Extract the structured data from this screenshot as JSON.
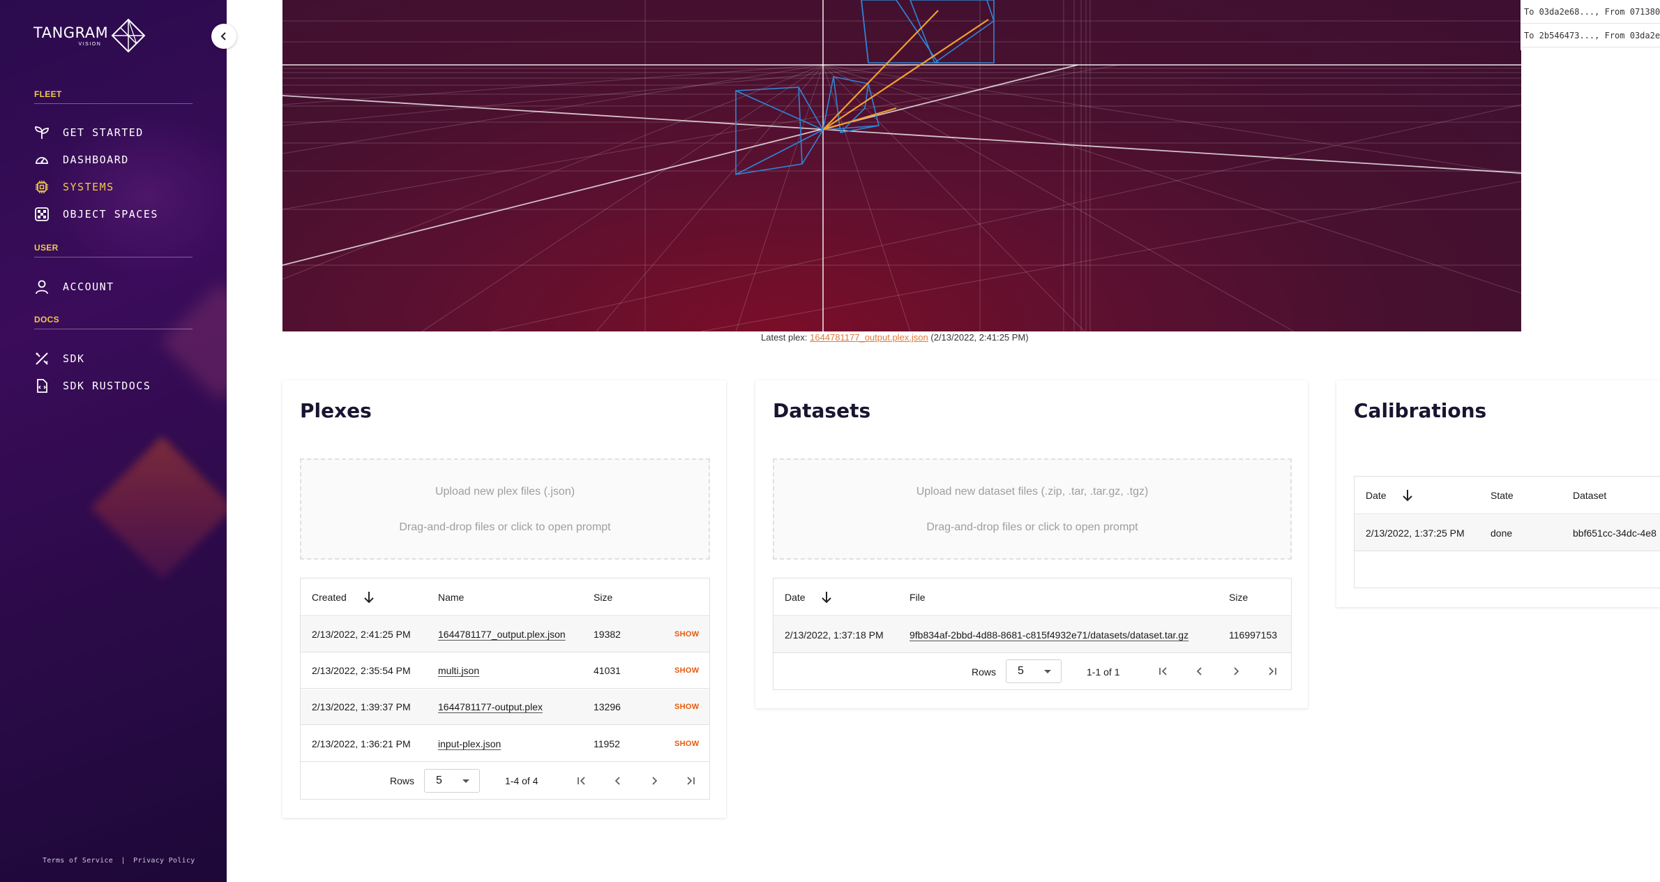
{
  "brand": {
    "name": "TANGRAM",
    "sub": "VISION"
  },
  "sidebar": {
    "sections": [
      {
        "title": "FLEET"
      },
      {
        "title": "USER"
      },
      {
        "title": "DOCS"
      }
    ],
    "items": [
      {
        "label": "GET STARTED",
        "icon": "sprout-icon"
      },
      {
        "label": "DASHBOARD",
        "icon": "gauge-icon"
      },
      {
        "label": "SYSTEMS",
        "icon": "chip-icon",
        "active": true
      },
      {
        "label": "OBJECT SPACES",
        "icon": "checkerboard-icon"
      },
      {
        "label": "ACCOUNT",
        "icon": "user-icon"
      },
      {
        "label": "SDK",
        "icon": "tools-icon"
      },
      {
        "label": "SDK RUSTDOCS",
        "icon": "code-file-icon"
      }
    ],
    "footer": {
      "terms": "Terms of Service",
      "sep": "|",
      "privacy": "Privacy Policy"
    }
  },
  "log": {
    "rows": [
      "To 03da2e68..., From 071380",
      "To 2b546473..., From 03da2e"
    ]
  },
  "viewer": {
    "latest_prefix": "Latest plex:",
    "latest_file": "1644781177_output.plex.json",
    "latest_date": "(2/13/2022, 2:41:25 PM)"
  },
  "plexes": {
    "title": "Plexes",
    "upload_line1": "Upload new plex files (.json)",
    "upload_line2": "Drag-and-drop files or click to open prompt",
    "columns": {
      "created": "Created",
      "name": "Name",
      "size": "Size"
    },
    "rows": [
      {
        "created": "2/13/2022, 2:41:25 PM",
        "name": "1644781177_output.plex.json",
        "size": "19382",
        "action": "SHOW"
      },
      {
        "created": "2/13/2022, 2:35:54 PM",
        "name": "multi.json",
        "size": "41031",
        "action": "SHOW"
      },
      {
        "created": "2/13/2022, 1:39:37 PM",
        "name": "1644781177-output.plex",
        "size": "13296",
        "action": "SHOW"
      },
      {
        "created": "2/13/2022, 1:36:21 PM",
        "name": "input-plex.json",
        "size": "11952",
        "action": "SHOW"
      }
    ],
    "pager": {
      "rows_label": "Rows",
      "rows_value": "5",
      "range": "1-4 of 4"
    }
  },
  "datasets": {
    "title": "Datasets",
    "upload_line1": "Upload new dataset files (.zip, .tar, .tar.gz, .tgz)",
    "upload_line2": "Drag-and-drop files or click to open prompt",
    "columns": {
      "date": "Date",
      "file": "File",
      "size": "Size"
    },
    "rows": [
      {
        "date": "2/13/2022, 1:37:18 PM",
        "file": "9fb834af-2bbd-4d88-8681-c815f4932e71/datasets/dataset.tar.gz",
        "size": "116997153"
      }
    ],
    "pager": {
      "rows_label": "Rows",
      "rows_value": "5",
      "range": "1-1 of 1"
    }
  },
  "calibrations": {
    "title": "Calibrations",
    "columns": {
      "date": "Date",
      "state": "State",
      "dataset": "Dataset"
    },
    "rows": [
      {
        "date": "2/13/2022, 1:37:25 PM",
        "state": "done",
        "dataset": "bbf651cc-34dc-4e8"
      }
    ]
  },
  "colors": {
    "accent": "#f2c94c",
    "link": "#e07a3a",
    "show": "#e8590c",
    "sidebar_bg": "#2b0b4d"
  }
}
